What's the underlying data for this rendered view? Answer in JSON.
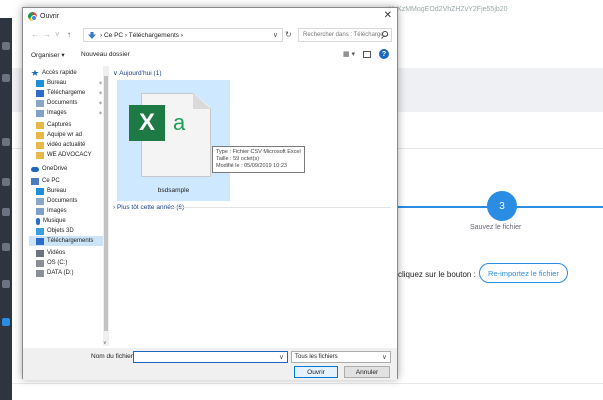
{
  "background_page": {
    "url_fragment": "eVzXzMMogEOd2VhZHZvY2Fje55jb20",
    "step_number": "3",
    "step_label": "Sauvez le fichier",
    "instruction": "cliquez sur le bouton :",
    "reimport_button": "Re-importez le fichier",
    "accent_color": "#2b8ce3"
  },
  "dialog": {
    "title": "Ouvrir",
    "close_glyph": "✕",
    "nav": {
      "back": "←",
      "forward": "→",
      "recent": "˅",
      "up": "↑",
      "path": "› Ce PC › Téléchargements ›",
      "refresh": "↻",
      "search_placeholder": "Rechercher dans : Télécharge..."
    },
    "toolbar": {
      "organiser": "Organiser ▾",
      "new_folder": "Nouveau dossier",
      "view": "▦ ▾",
      "help": "?"
    },
    "navpane": {
      "items": [
        {
          "label": "Accès rapide",
          "icon": "star-icon",
          "pinned": false,
          "indent": 0
        },
        {
          "label": "Bureau",
          "icon": "desktop-icon",
          "pinned": true,
          "indent": 1
        },
        {
          "label": "Téléchargeme",
          "icon": "download-icon",
          "pinned": true,
          "indent": 1
        },
        {
          "label": "Documents",
          "icon": "documents-icon",
          "pinned": true,
          "indent": 1
        },
        {
          "label": "Images",
          "icon": "images-icon",
          "pinned": true,
          "indent": 1
        },
        {
          "label": "Captures",
          "icon": "folder-icon",
          "pinned": false,
          "indent": 1
        },
        {
          "label": "Aquipe wr ad",
          "icon": "folder-icon",
          "pinned": false,
          "indent": 1
        },
        {
          "label": "vidéo actualité",
          "icon": "folder-icon",
          "pinned": false,
          "indent": 1
        },
        {
          "label": "WE ADVOCACY",
          "icon": "folder-icon",
          "pinned": false,
          "indent": 1
        },
        {
          "label": "OneDrive",
          "icon": "cloud-icon",
          "pinned": false,
          "indent": 0
        },
        {
          "label": "Ce PC",
          "icon": "pc-icon",
          "pinned": false,
          "indent": 0
        },
        {
          "label": "Bureau",
          "icon": "desktop-icon",
          "pinned": false,
          "indent": 1
        },
        {
          "label": "Documents",
          "icon": "documents-icon",
          "pinned": false,
          "indent": 1
        },
        {
          "label": "Images",
          "icon": "images-icon",
          "pinned": false,
          "indent": 1
        },
        {
          "label": "Musique",
          "icon": "music-icon",
          "pinned": false,
          "indent": 1
        },
        {
          "label": "Objets 3D",
          "icon": "objects3d-icon",
          "pinned": false,
          "indent": 1
        },
        {
          "label": "Téléchargements",
          "icon": "download-icon",
          "pinned": false,
          "indent": 1,
          "selected": true
        },
        {
          "label": "Vidéos",
          "icon": "videos-icon",
          "pinned": false,
          "indent": 1
        },
        {
          "label": "OS (C:)",
          "icon": "drive-icon",
          "pinned": false,
          "indent": 1
        },
        {
          "label": "DATA (D:)",
          "icon": "drive-icon",
          "pinned": false,
          "indent": 1
        }
      ]
    },
    "content": {
      "group_today": "∨ Aujourd’hui (1)",
      "group_earlier": "› Plus tôt cette année (6)",
      "file": {
        "name": "bsdsample",
        "excel_letter": "X",
        "icon_letter": "a"
      },
      "tooltip": {
        "type": "Type : Fichier CSV Microsoft Excel",
        "size": "Taille : 59 octet(s)",
        "modified": "Modifié le : 05/09/2019 10:23"
      }
    },
    "bottom": {
      "filename_label": "Nom du fichier :",
      "filename_value": "",
      "filetype": "Tous les fichiers",
      "open_button": "Ouvrir",
      "cancel_button": "Annuler"
    }
  }
}
